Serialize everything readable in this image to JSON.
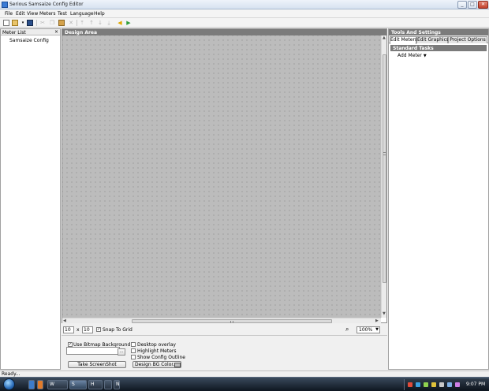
{
  "window": {
    "title": "Serious Samsaize Config Editor",
    "minimize": "_",
    "maximize": "□",
    "close": "✕"
  },
  "menu": [
    "File",
    "Edit",
    "View",
    "Meters",
    "Test",
    "Language",
    "Help"
  ],
  "toolbar": {
    "icons": [
      "new-icon",
      "open-icon",
      "dropdown-icon",
      "save-icon",
      "cut-icon",
      "copy-icon",
      "paste-icon",
      "delete-icon",
      "align-top-icon",
      "move-up-icon",
      "move-down-icon",
      "align-bottom-icon",
      "back-arrow-icon",
      "forward-arrow-icon"
    ]
  },
  "meter_list": {
    "title": "Meter List",
    "close": "×",
    "items": [
      "Samsaize Config"
    ]
  },
  "design_area": {
    "title": "Design Area"
  },
  "controls": {
    "grid_x": "10",
    "separator": "x",
    "grid_y": "10",
    "snap_to_grid": "Snap To Grid",
    "snap_checked": true,
    "zoom": "100%"
  },
  "bottom": {
    "use_bitmap": "Use Bitmap Background",
    "use_bitmap_checked": true,
    "browse": "...",
    "take_screenshot": "Take ScreenShot",
    "desktop_overlay": "Desktop overlay",
    "highlight_meters": "Highlight Meters",
    "show_outline": "Show Config Outline",
    "design_bg_color": "Design BG Color...",
    "design_bg_swatch": "#bcbcbc"
  },
  "tools": {
    "title": "Tools And Settings",
    "tabs": [
      "Edit Meters",
      "Edit Graphics",
      "Project Options"
    ],
    "active_tab": "Edit Meters",
    "section": "Standard Tasks",
    "add_meter": "Add Meter"
  },
  "status": {
    "text": "Ready..."
  },
  "taskbar": {
    "buttons": [
      "W",
      "S",
      "H",
      "",
      "N"
    ],
    "clock": "9:07 PM"
  },
  "colors": {
    "panel_header": "#7b7b7b",
    "grid": "#bcbcbc",
    "taskbar": "#1c2735"
  }
}
